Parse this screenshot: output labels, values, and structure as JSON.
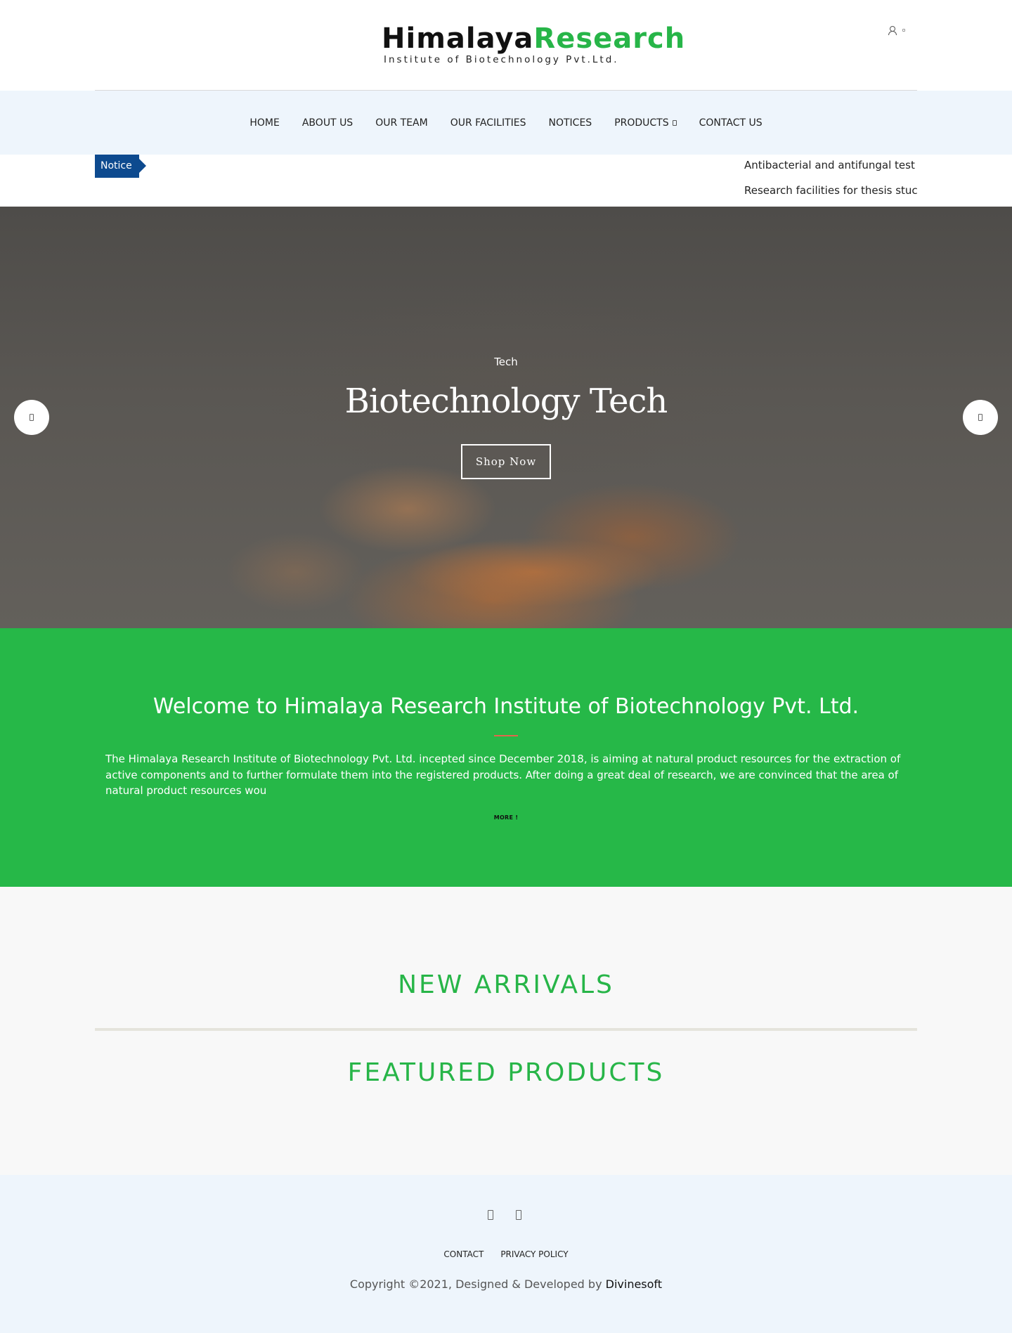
{
  "brand": {
    "logo_word1": "Himalaya",
    "logo_word2": "Research",
    "logo_tagline": "Institute of Biotechnology Pvt.Ltd.",
    "accent_green": "#27b548",
    "notice_blue": "#0d4a8f"
  },
  "header_icons": [
    "user-icon",
    "small-icon"
  ],
  "nav": {
    "items": [
      {
        "label": "HOME"
      },
      {
        "label": "ABOUT US"
      },
      {
        "label": "OUR TEAM"
      },
      {
        "label": "OUR FACILITIES"
      },
      {
        "label": "NOTICES"
      },
      {
        "label": "PRODUCTS",
        "has_dropdown": true
      },
      {
        "label": "CONTACT US"
      }
    ]
  },
  "notice": {
    "tag": "Notice",
    "items": [
      "Antibacterial and antifungal test",
      "Research facilities for thesis stuc"
    ]
  },
  "hero": {
    "kicker": "Tech",
    "title": "Biotechnology Tech",
    "button": "Shop Now"
  },
  "welcome": {
    "title": "Welcome to Himalaya Research Institute of Biotechnology Pvt. Ltd.",
    "text": "The Himalaya Research Institute of Biotechnology Pvt. Ltd. incepted since December 2018, is aiming at natural product resources for the extraction of active components and to further formulate them into the registered products. After doing a great deal of research, we are convinced that the area of natural product resources wou",
    "more": "MORE !"
  },
  "products": {
    "new_arrivals": "NEW ARRIVALS",
    "featured": "FEATURED PRODUCTS"
  },
  "footer": {
    "social_icons": [
      "facebook-icon",
      "twitter-icon"
    ],
    "links": [
      "CONTACT",
      "PRIVACY POLICY"
    ],
    "copyright": "Copyright ©2021, Designed & Developed by",
    "developer": "Divinesoft"
  }
}
